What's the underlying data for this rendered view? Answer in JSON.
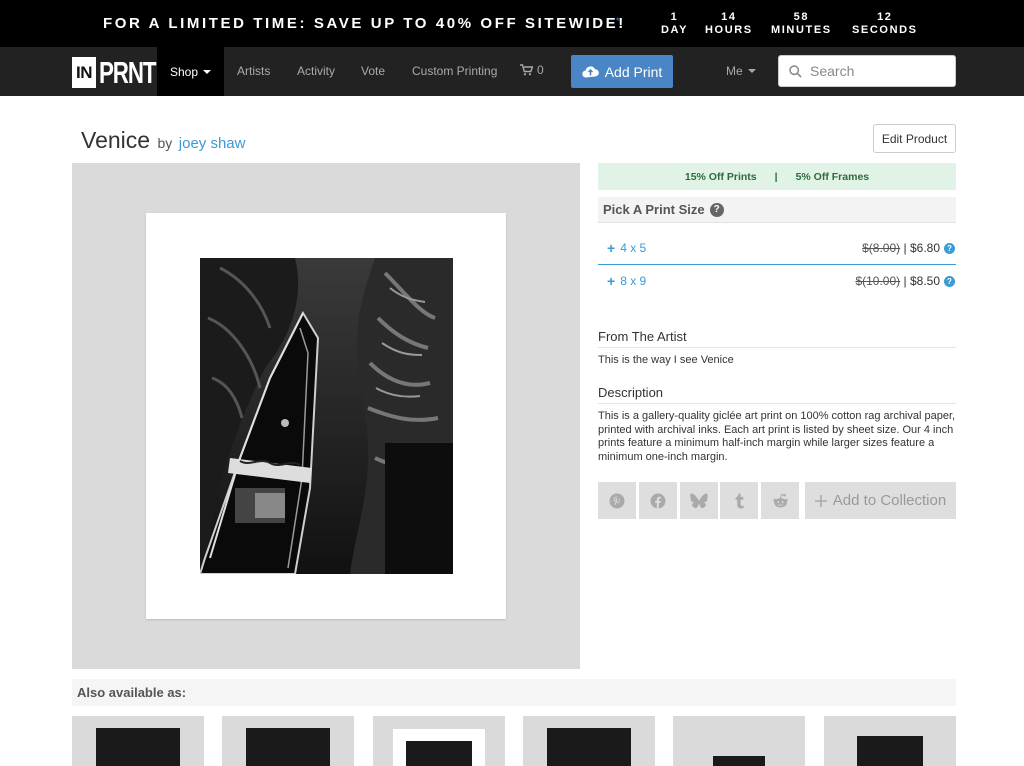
{
  "promo": {
    "text": "FOR A LIMITED TIME: SAVE UP TO 40% OFF SITEWIDE!",
    "marker": "*",
    "countdown": [
      {
        "value": "1",
        "unit": "DAY"
      },
      {
        "value": "14",
        "unit": "HOURS"
      },
      {
        "value": "58",
        "unit": "MINUTES"
      },
      {
        "value": "12",
        "unit": "SECONDS"
      }
    ]
  },
  "nav": {
    "logo_in": "IN",
    "logo_prnt": "PRNT",
    "shop": "Shop",
    "links": [
      "Artists",
      "Activity",
      "Vote",
      "Custom Printing"
    ],
    "cart_count": "0",
    "add_print": "Add Print",
    "me": "Me",
    "search_placeholder": "Search"
  },
  "product": {
    "title": "Venice",
    "by": "by",
    "artist": "joey shaw",
    "edit_button": "Edit Product"
  },
  "deals": {
    "prints": "15% Off Prints",
    "separator": "|",
    "frames": "5% Off Frames"
  },
  "print_sizes": {
    "heading": "Pick A Print Size",
    "help": "?",
    "options": [
      {
        "size": "4 x 5",
        "old_price": "$(8.00)",
        "sep": "|",
        "price": "$6.80"
      },
      {
        "size": "8 x 9",
        "old_price": "$(10.00)",
        "sep": "|",
        "price": "$8.50"
      }
    ]
  },
  "from_artist": {
    "heading": "From The Artist",
    "text": "This is the way I see Venice"
  },
  "description": {
    "heading": "Description",
    "text": "This is a gallery-quality giclée art print on 100% cotton rag archival paper, printed with archival inks. Each art print is listed by sheet size. Our 4 inch prints feature a minimum half-inch margin while larger sizes feature a minimum one-inch margin."
  },
  "share_icons": [
    "pinterest-icon",
    "facebook-icon",
    "bluesky-icon",
    "tumblr-icon",
    "reddit-icon"
  ],
  "collection_button": "Add to Collection",
  "also_available": {
    "heading": "Also available as:"
  },
  "colors": {
    "accent_blue": "#3a9bd5",
    "button_blue": "#4a86c5",
    "deal_green_bg": "#e1f3e6",
    "nav_bg": "#222222"
  }
}
